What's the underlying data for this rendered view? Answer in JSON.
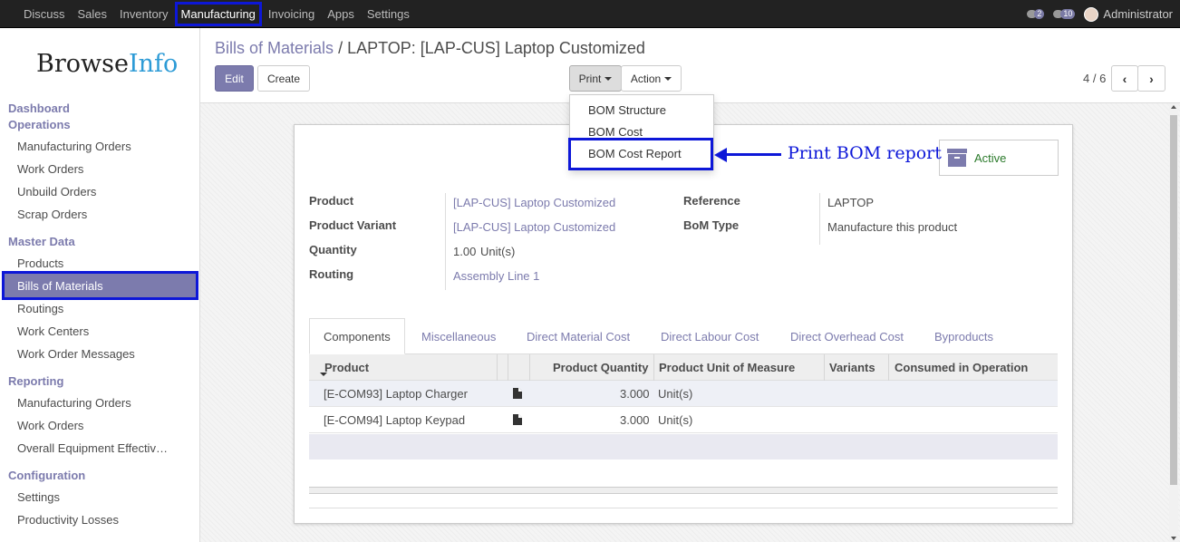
{
  "topbar": {
    "menu": [
      "Discuss",
      "Sales",
      "Inventory",
      "Manufacturing",
      "Invoicing",
      "Apps",
      "Settings"
    ],
    "active": "Manufacturing",
    "chat_count": "2",
    "activity_count": "10",
    "user": "Administrator"
  },
  "sidebar": {
    "logo_a": "Browse",
    "logo_b": "Info",
    "sections": {
      "dashboard": "Dashboard",
      "operations": "Operations",
      "master": "Master Data",
      "reporting": "Reporting",
      "configuration": "Configuration"
    },
    "operations_items": [
      "Manufacturing Orders",
      "Work Orders",
      "Unbuild Orders",
      "Scrap Orders"
    ],
    "master_items": [
      "Products",
      "Bills of Materials",
      "Routings",
      "Work Centers",
      "Work Order Messages"
    ],
    "reporting_items": [
      "Manufacturing Orders",
      "Work Orders",
      "Overall Equipment Effectiv…"
    ],
    "configuration_items": [
      "Settings",
      "Productivity Losses"
    ]
  },
  "breadcrumb": {
    "parent": "Bills of Materials",
    "sep": "/",
    "current": "LAPTOP: [LAP-CUS] Laptop Customized"
  },
  "buttons": {
    "edit": "Edit",
    "create": "Create",
    "print": "Print",
    "action": "Action"
  },
  "pager": {
    "text": "4 / 6",
    "prev": "‹",
    "next": "›"
  },
  "print_menu": [
    "BOM Structure",
    "BOM Cost",
    "BOM Cost Report"
  ],
  "annotation": "Print BOM report",
  "status": "Active",
  "form": {
    "product_label": "Product",
    "product_value": "[LAP-CUS] Laptop Customized",
    "variant_label": "Product Variant",
    "variant_value": "[LAP-CUS] Laptop Customized",
    "quantity_label": "Quantity",
    "quantity_value": "1.00",
    "quantity_uom": "Unit(s)",
    "routing_label": "Routing",
    "routing_value": "Assembly Line 1",
    "reference_label": "Reference",
    "reference_value": "LAPTOP",
    "bomtype_label": "BoM Type",
    "bomtype_value": "Manufacture this product"
  },
  "tabs": [
    "Components",
    "Miscellaneous",
    "Direct Material Cost",
    "Direct Labour Cost",
    "Direct Overhead Cost",
    "Byproducts"
  ],
  "table": {
    "headers": {
      "product": "Product",
      "qty": "Product Quantity",
      "uom": "Product Unit of Measure",
      "variants": "Variants",
      "consumed": "Consumed in Operation"
    },
    "rows": [
      {
        "product": "[E-COM93] Laptop Charger",
        "qty": "3.000",
        "uom": "Unit(s)"
      },
      {
        "product": "[E-COM94] Laptop Keypad",
        "qty": "3.000",
        "uom": "Unit(s)"
      }
    ]
  }
}
